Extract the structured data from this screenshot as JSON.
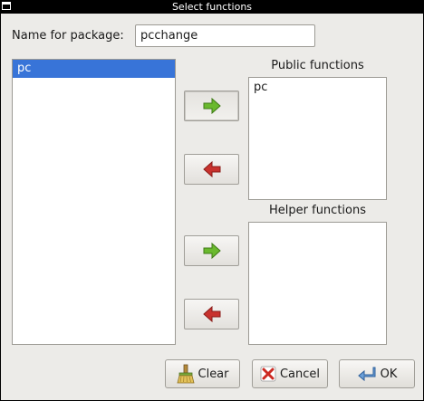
{
  "window": {
    "title": "Select functions"
  },
  "form": {
    "name_label": "Name for package:",
    "name_value": "pcchange"
  },
  "available_list": {
    "items": [
      "pc"
    ]
  },
  "public_section": {
    "label": "Public functions",
    "items": [
      "pc"
    ]
  },
  "helper_section": {
    "label": "Helper functions",
    "items": []
  },
  "buttons": {
    "clear": "Clear",
    "cancel": "Cancel",
    "ok": "OK"
  },
  "icons": {
    "add_public": "right-arrow-icon",
    "remove_public": "left-arrow-icon",
    "add_helper": "right-arrow-icon",
    "remove_helper": "left-arrow-icon",
    "clear": "broom-icon",
    "cancel": "cancel-x-icon",
    "ok": "enter-arrow-icon"
  },
  "colors": {
    "add_arrow": "#6ab92e",
    "remove_arrow": "#c8322e",
    "selection": "#3874d8"
  }
}
